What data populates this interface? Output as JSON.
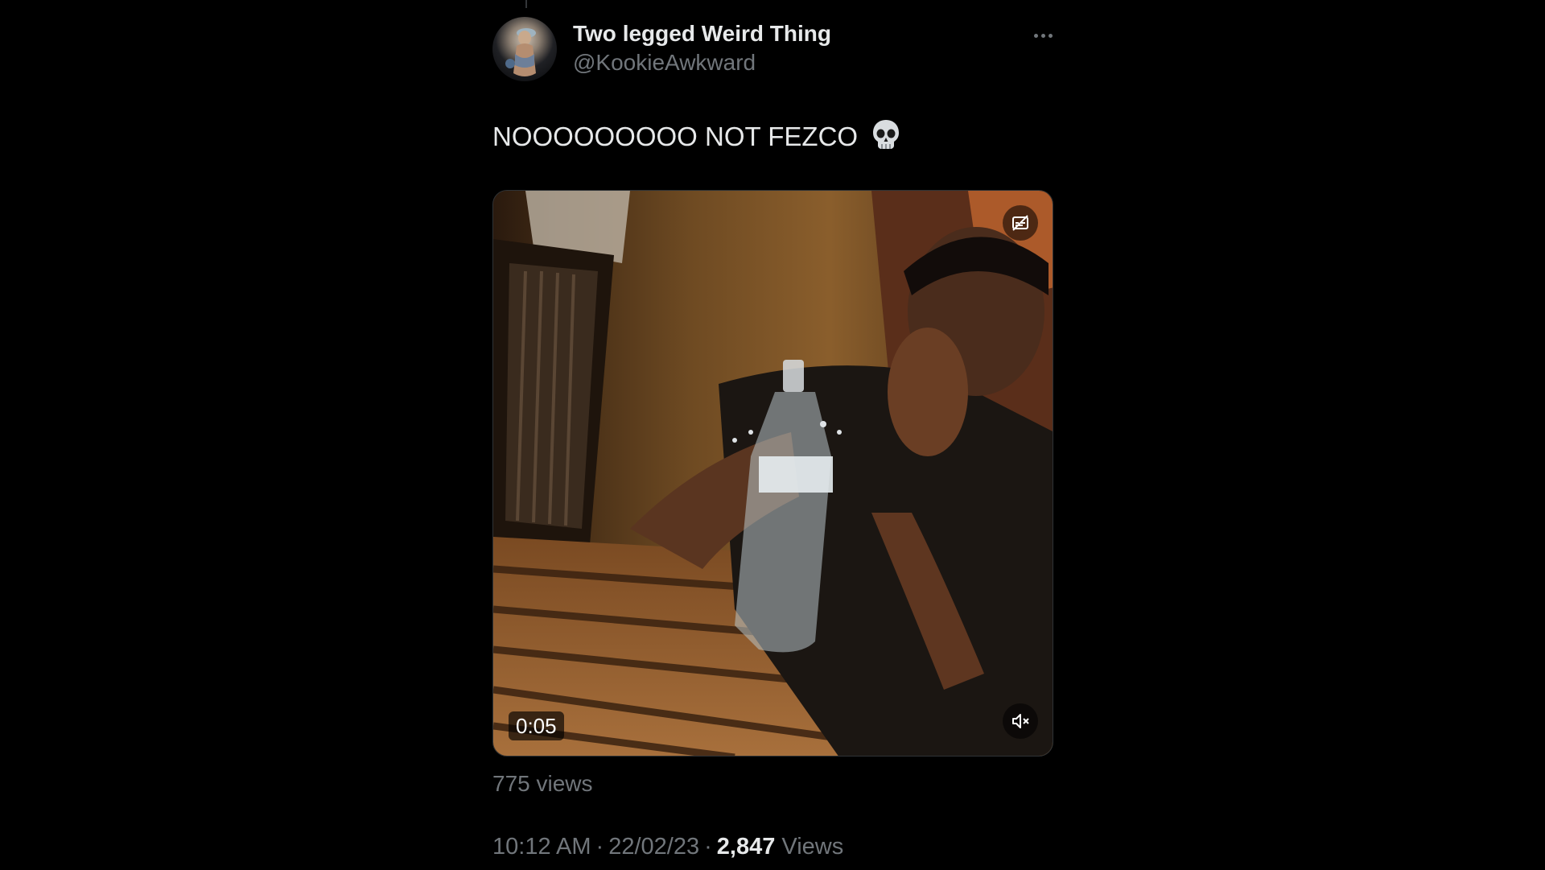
{
  "author": {
    "display_name": "Two legged Weird Thing",
    "handle": "@KookieAwkward",
    "avatar_icon": "profile-avatar"
  },
  "tweet": {
    "text": "NOOOOOOOOO NOT FEZCO",
    "emoji": "💀"
  },
  "media": {
    "type": "video",
    "duration": "0:05",
    "view_count_label": "775 views",
    "controls": [
      "captions-icon",
      "mute-icon"
    ]
  },
  "meta": {
    "time": "10:12 AM",
    "date": "22/02/23",
    "separator": "·",
    "views_count": "2,847",
    "views_label": "Views"
  },
  "colors": {
    "background": "#000000",
    "primary_text": "#e7e9ea",
    "secondary_text": "#71767b"
  }
}
